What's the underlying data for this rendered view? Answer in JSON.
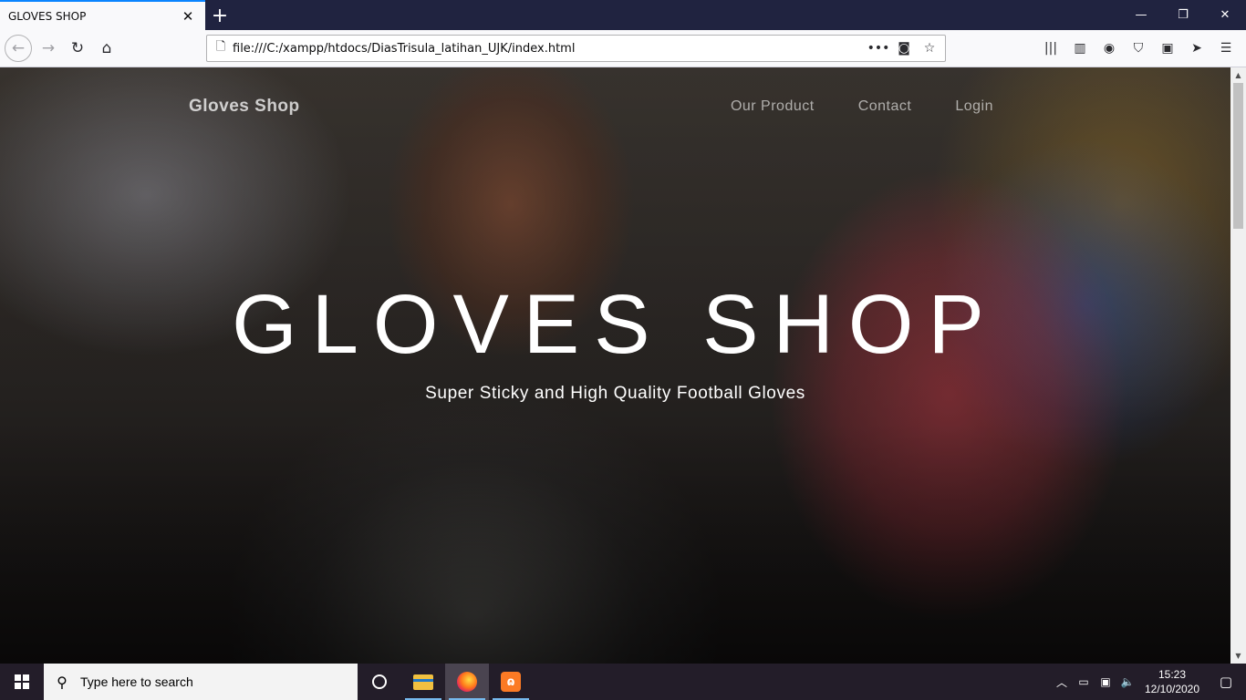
{
  "browser": {
    "tab_title": "GLOVES SHOP",
    "tab_close": "✕",
    "new_tab": "+",
    "url": "file:///C:/xampp/htdocs/DiasTrisula_latihan_UJK/index.html",
    "window_controls": {
      "minimize": "—",
      "restore": "❐",
      "close": "✕"
    },
    "nav_icons": {
      "back": "←",
      "forward": "→",
      "reload": "↻",
      "home": "⌂"
    },
    "url_icons": {
      "page": "🗋",
      "more": "•••",
      "pocket": "◙",
      "bookmark": "☆"
    },
    "toolbar_icons": [
      "library-icon",
      "sidebar-icon",
      "account-icon",
      "ublock-icon",
      "extension-icon",
      "send-icon",
      "menu-icon"
    ],
    "toolbar_glyphs": [
      "|||",
      "▥",
      "◉",
      "⛉",
      "▣",
      "➤",
      "☰"
    ]
  },
  "site": {
    "brand": "Gloves Shop",
    "menu": [
      {
        "label": "Our Product"
      },
      {
        "label": "Contact"
      },
      {
        "label": "Login"
      }
    ],
    "hero_title": "GLOVES SHOP",
    "hero_subtitle": "Super Sticky and High Quality Football Gloves"
  },
  "scrollbar": {
    "up": "▲",
    "down": "▼"
  },
  "taskbar": {
    "search_placeholder": "Type here to search",
    "search_glyph": "⚲",
    "xampp_glyph": "ɷ",
    "tray_glyphs": {
      "chevron": "︿",
      "battery": "▭",
      "network": "▣",
      "volume": "🔈",
      "notifications": "▢"
    },
    "time": "15:23",
    "date": "12/10/2020"
  },
  "colors": {
    "tab_accent": "#0a84ff",
    "titlebar": "#202340",
    "taskbar": "#231d29"
  }
}
